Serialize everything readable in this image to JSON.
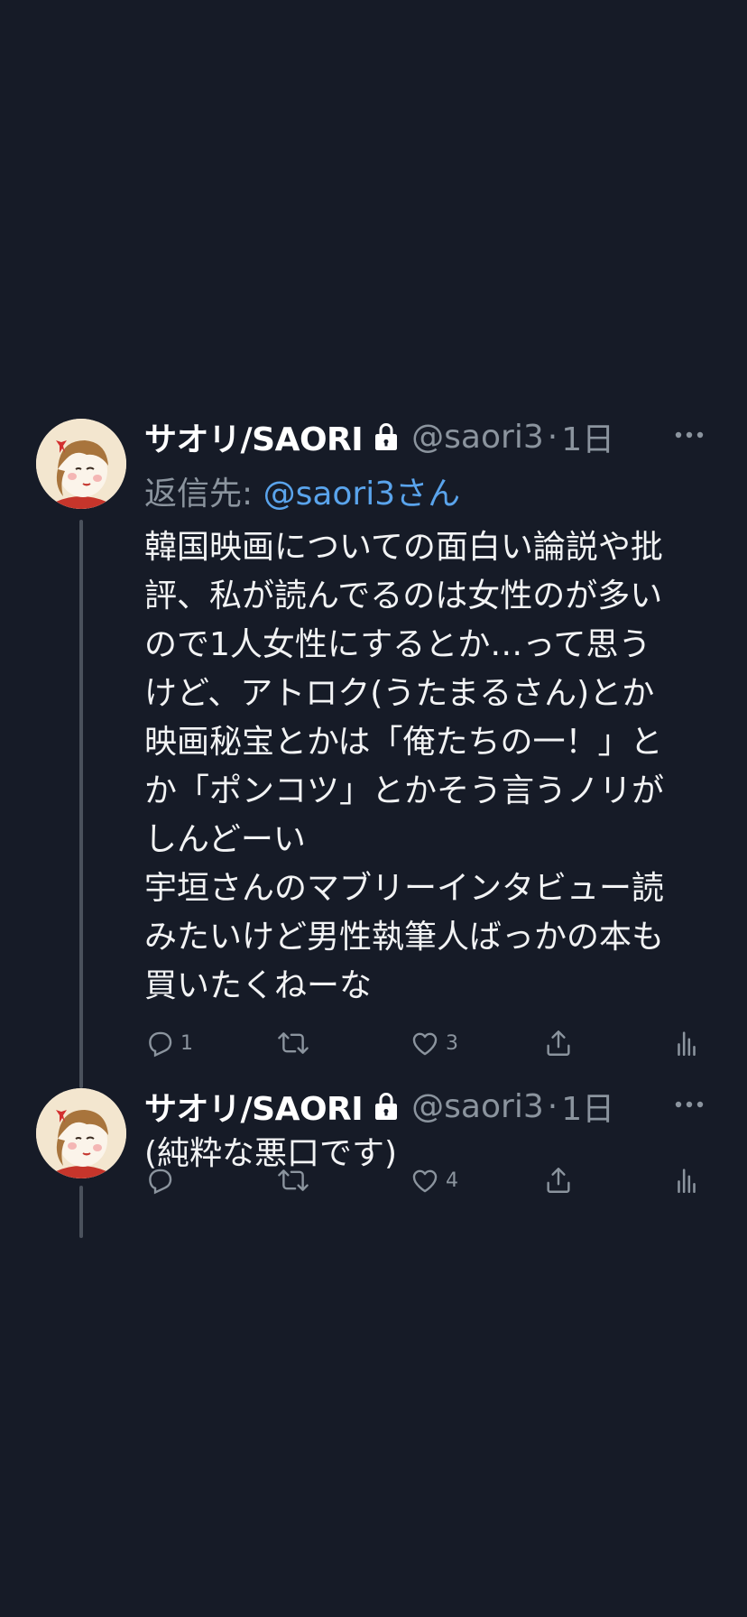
{
  "tweets": [
    {
      "author_name": "サオリ/SAORI",
      "handle": "@saori3",
      "separator": "·",
      "time": "1日",
      "reply_prefix": "返信先:",
      "reply_mention": "@saori3さん",
      "text": "韓国映画についての面白い論説や批\n評、私が読んでるのは女性のが多い\nので1人女性にするとか…って思う\nけど、アトロク(うたまるさん)とか\n映画秘宝とかは「俺たちの一！」と\nか「ポンコツ」とかそう言うノリが\nしんどーい\n宇垣さんのマブリーインタビュー読\nみたいけど男性執筆人ばっかの本も\n買いたくねーな",
      "reply_count": "1",
      "retweet_count": "",
      "like_count": "3"
    },
    {
      "author_name": "サオリ/SAORI",
      "handle": "@saori3",
      "separator": "·",
      "time": "1日",
      "text": "(純粋な悪口です)",
      "reply_count": "",
      "retweet_count": "",
      "like_count": "4"
    }
  ],
  "icons": {
    "more": "more-horizontal-icon",
    "lock": "lock-icon",
    "reply": "reply-icon",
    "retweet": "retweet-icon",
    "like": "heart-icon",
    "share": "share-icon",
    "views": "analytics-icon"
  },
  "colors": {
    "background": "#161b27",
    "mention": "#5aa4ec",
    "secondary_text": "#8b949e",
    "thread_line": "#4a515c"
  }
}
